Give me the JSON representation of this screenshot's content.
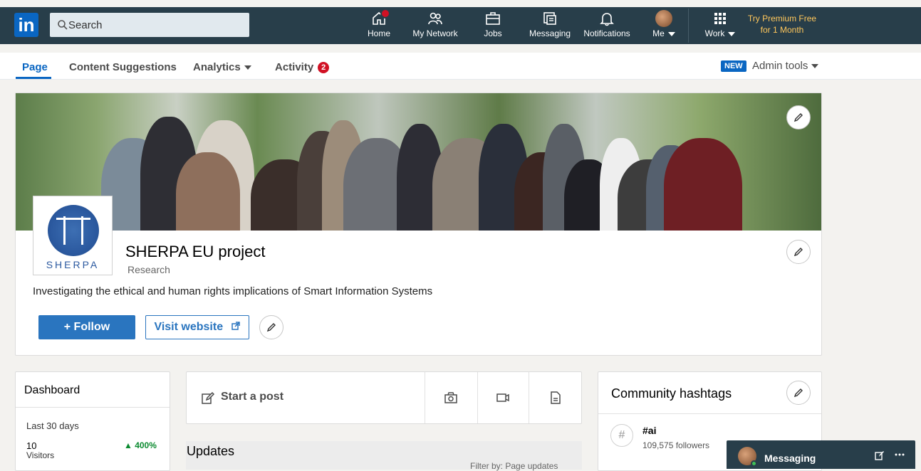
{
  "nav": {
    "logo": "in",
    "search_placeholder": "Search",
    "items": [
      {
        "label": "Home",
        "icon": "home-icon"
      },
      {
        "label": "My Network",
        "icon": "network-icon"
      },
      {
        "label": "Jobs",
        "icon": "briefcase-icon"
      },
      {
        "label": "Messaging",
        "icon": "messaging-icon"
      },
      {
        "label": "Notifications",
        "icon": "bell-icon"
      },
      {
        "label": "Me",
        "icon": "avatar"
      },
      {
        "label": "Work",
        "icon": "grid-icon"
      }
    ],
    "premium_line1": "Try Premium Free",
    "premium_line2": "for 1 Month"
  },
  "subnav": {
    "tabs": [
      {
        "label": "Page"
      },
      {
        "label": "Content Suggestions"
      },
      {
        "label": "Analytics"
      },
      {
        "label": "Activity",
        "badge": "2"
      }
    ],
    "new_badge": "NEW",
    "admin_tools": "Admin tools"
  },
  "profile": {
    "logo_text": "SHERPA",
    "name": "SHERPA EU project",
    "industry": "Research",
    "tagline": "Investigating the ethical and human rights implications of Smart Information Systems",
    "follow_label": "+ Follow",
    "visit_label": "Visit website"
  },
  "dashboard": {
    "title": "Dashboard",
    "period": "Last 30 days",
    "visitors_count": "10",
    "visitors_change": "▲ 400%",
    "visitors_label": "Visitors"
  },
  "post": {
    "start_label": "Start a post"
  },
  "updates": {
    "title": "Updates",
    "filter": "Filter by: Page updates"
  },
  "hashtags": {
    "title": "Community hashtags",
    "items": [
      {
        "tag": "#ai",
        "followers": "109,575 followers"
      }
    ]
  },
  "messaging": {
    "label": "Messaging"
  },
  "colors": {
    "nav_bg": "#283e4a",
    "accent": "#0a66c2",
    "premium": "#ffc75b",
    "badge": "#d11124"
  }
}
